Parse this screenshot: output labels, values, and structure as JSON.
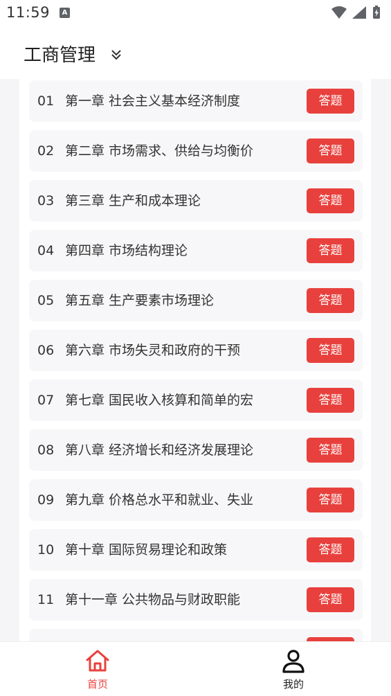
{
  "status_bar": {
    "time": "11:59",
    "notification_letter": "A"
  },
  "header": {
    "title": "工商管理"
  },
  "chapters": [
    {
      "num": "01",
      "title": "第一章 社会主义基本经济制度",
      "button": "答题"
    },
    {
      "num": "02",
      "title": "第二章 市场需求、供给与均衡价",
      "button": "答题"
    },
    {
      "num": "03",
      "title": "第三章 生产和成本理论",
      "button": "答题"
    },
    {
      "num": "04",
      "title": "第四章 市场结构理论",
      "button": "答题"
    },
    {
      "num": "05",
      "title": "第五章 生产要素市场理论",
      "button": "答题"
    },
    {
      "num": "06",
      "title": "第六章 市场失灵和政府的干预",
      "button": "答题"
    },
    {
      "num": "07",
      "title": "第七章 国民收入核算和简单的宏",
      "button": "答题"
    },
    {
      "num": "08",
      "title": "第八章 经济增长和经济发展理论",
      "button": "答题"
    },
    {
      "num": "09",
      "title": "第九章 价格总水平和就业、失业",
      "button": "答题"
    },
    {
      "num": "10",
      "title": "第十章 国际贸易理论和政策",
      "button": "答题"
    },
    {
      "num": "11",
      "title": "第十一章 公共物品与财政职能",
      "button": "答题"
    },
    {
      "num": "",
      "title": "",
      "button": ""
    }
  ],
  "bottom_nav": {
    "home_label": "首页",
    "mine_label": "我的",
    "active_color": "#e8413d",
    "inactive_color": "#222222"
  },
  "colors": {
    "accent": "#e8413d",
    "item_bg": "#f7f7f9",
    "page_bg": "#f5f5f7"
  }
}
